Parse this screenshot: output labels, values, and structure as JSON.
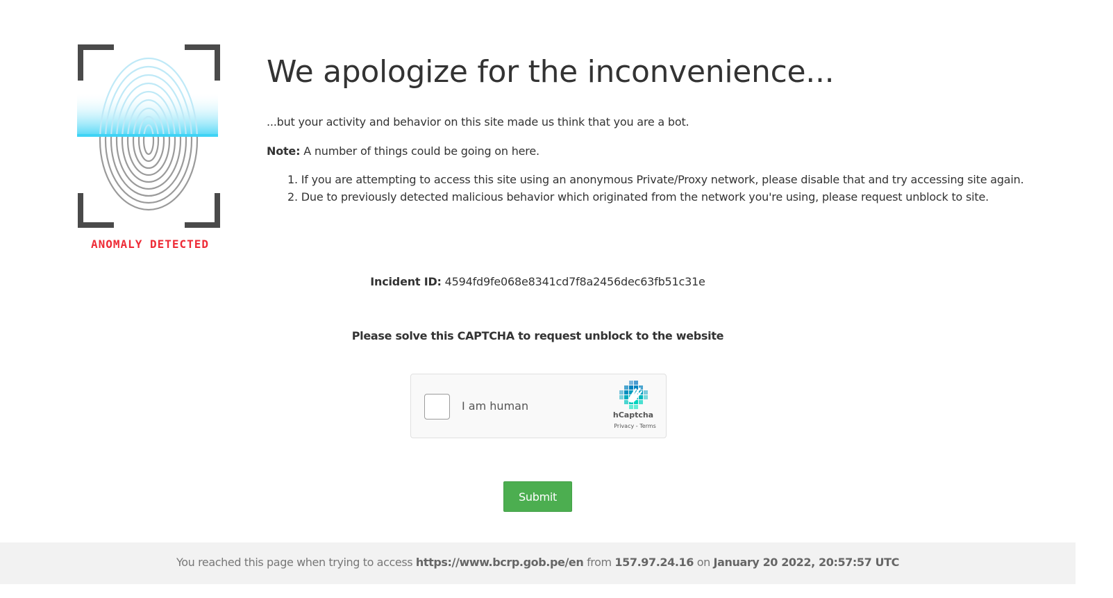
{
  "logo": {
    "caption": "ANOMALY DETECTED",
    "icon": "fingerprint-scan-icon",
    "caption_color": "#ee2b36",
    "scan_color": "#3fd3f5"
  },
  "headline": "We apologize for the inconvenience...",
  "intro": "...but your activity and behavior on this site made us think that you are a bot.",
  "note": {
    "label": "Note:",
    "text": "A number of things could be going on here."
  },
  "reasons": [
    "1. If you are attempting to access this site using an anonymous Private/Proxy network, please disable that and try accessing site again.",
    "2. Due to previously detected malicious behavior which originated from the network you're using, please request unblock to site."
  ],
  "incident": {
    "label": "Incident ID:",
    "value": "4594fd9fe068e8341cd7f8a2456dec63fb51c31e"
  },
  "captcha_prompt": "Please solve this CAPTCHA to request unblock to the website",
  "hcaptcha": {
    "checkbox_label": "I am human",
    "brand": "hCaptcha",
    "privacy_link": "Privacy",
    "separator": "-",
    "terms_link": "Terms",
    "checked": false
  },
  "submit_label": "Submit",
  "submit_color": "#4cae50",
  "footer": {
    "prefix": "You reached this page when trying to access",
    "url": "https://www.bcrp.gob.pe/en",
    "from_word": "from",
    "ip": "157.97.24.16",
    "on_word": "on",
    "timestamp": "January 20 2022, 20:57:57 UTC"
  }
}
